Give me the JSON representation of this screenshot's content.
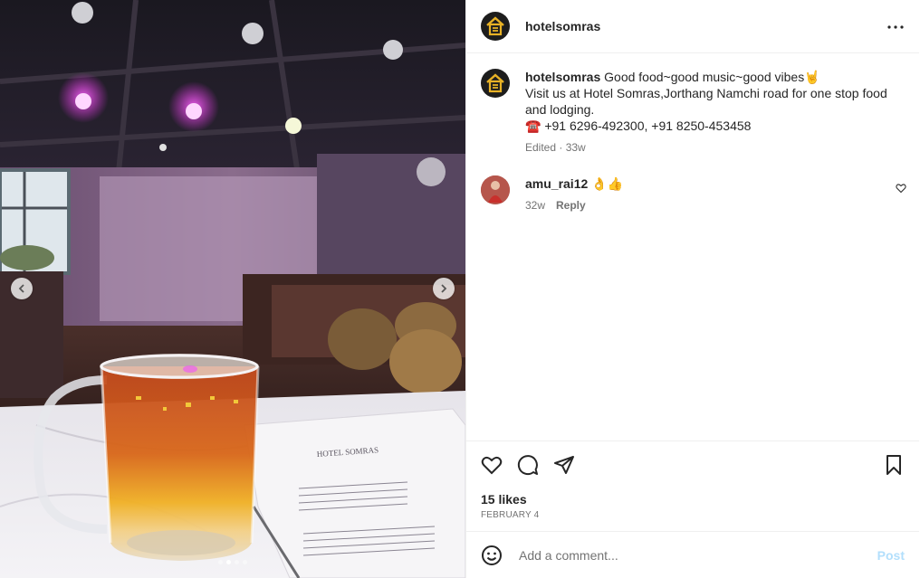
{
  "post": {
    "username": "hotelsomras",
    "more_icon": "ellipsis-icon",
    "caption": {
      "username": "hotelsomras",
      "line1": "Good food~good music~good vibes🤘",
      "line2": "Visit us at Hotel Somras,Jorthang Namchi road for one stop food and lodging.",
      "phone_emoji": "☎️",
      "phone": "+91 6296-492300, +91 8250-453458",
      "meta": "Edited · 33w"
    },
    "comments": [
      {
        "username": "amu_rai12",
        "text": "👌👍",
        "time": "32w",
        "reply_label": "Reply"
      }
    ],
    "likes": "15 likes",
    "date": "FEBRUARY 4",
    "comment_placeholder": "Add a comment...",
    "post_label": "Post"
  },
  "media": {
    "menu_title": "HOTEL SOMRAS",
    "carousel_count": 4,
    "carousel_active": 2
  },
  "colors": {
    "accent_disabled": "#b2dffc",
    "muted_text": "#737373",
    "logo_gold": "#e8b225"
  }
}
